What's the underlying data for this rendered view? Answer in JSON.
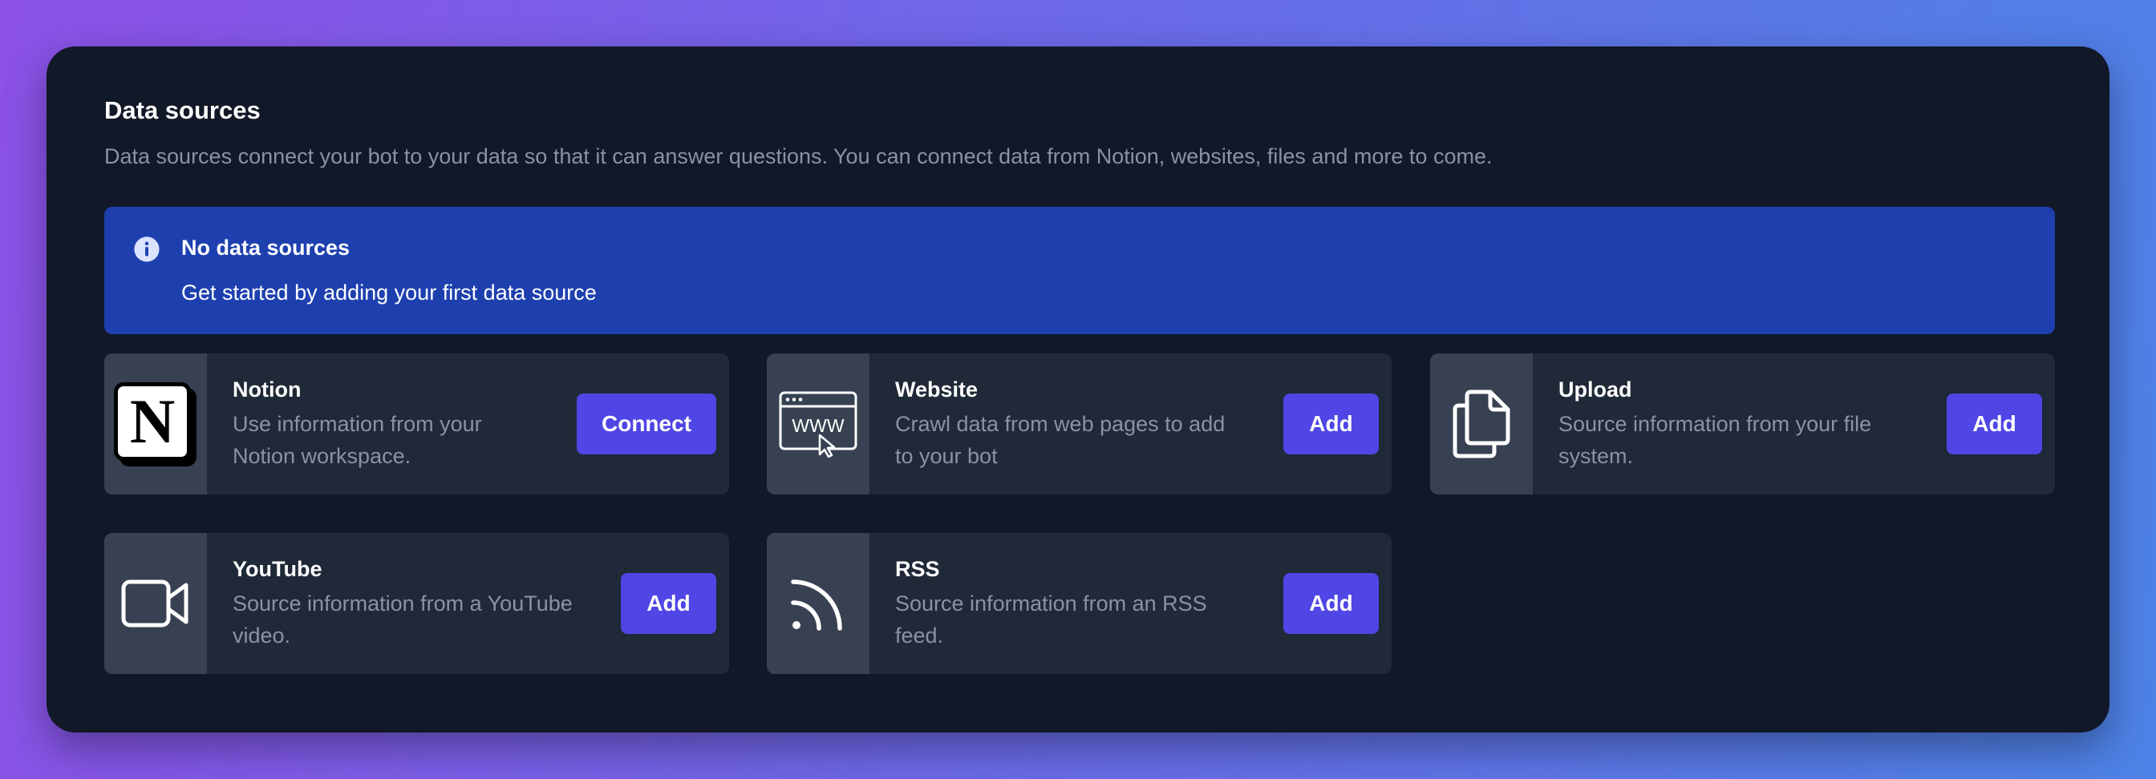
{
  "header": {
    "title": "Data sources",
    "subtitle": "Data sources connect your bot to your data so that it can answer questions. You can connect data from Notion, websites, files and more to come."
  },
  "alert": {
    "title": "No data sources",
    "text": "Get started by adding your first data source",
    "icon": "info-circle-icon"
  },
  "sources": [
    {
      "name": "Notion",
      "desc_line1": "Use information from your",
      "desc_line2": "Notion workspace.",
      "button": "Connect",
      "icon": "notion-logo-icon"
    },
    {
      "name": "Website",
      "desc_line1": "Crawl data from web pages to add",
      "desc_line2": "to your bot",
      "button": "Add",
      "icon": "www-browser-icon",
      "icon_text": "WWW"
    },
    {
      "name": "Upload",
      "desc_line1": "Source information from your file",
      "desc_line2": "system.",
      "button": "Add",
      "icon": "document-copy-icon"
    },
    {
      "name": "YouTube",
      "desc_line1": "Source information from a YouTube",
      "desc_line2": "video.",
      "button": "Add",
      "icon": "video-camera-icon"
    },
    {
      "name": "RSS",
      "desc_line1": "Source information from an RSS",
      "desc_line2": "feed.",
      "button": "Add",
      "icon": "rss-icon"
    }
  ],
  "colors": {
    "panel": "#111827",
    "card": "#1f2937",
    "thumb": "#374151",
    "alert": "#1e40af",
    "accent": "#4f46e5",
    "muted_text": "#8a93a3"
  }
}
